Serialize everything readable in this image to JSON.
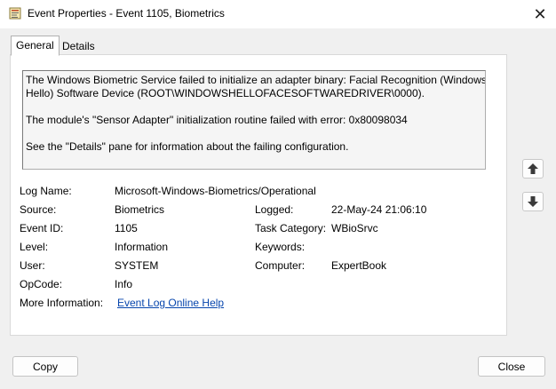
{
  "window": {
    "title": "Event Properties - Event 1105, Biometrics",
    "icon": "event-viewer-icon",
    "close_glyph": "✕"
  },
  "tabs": [
    {
      "label": "General",
      "active": true
    },
    {
      "label": "Details",
      "active": false
    }
  ],
  "description": {
    "line1": "The Windows Biometric Service failed to initialize an adapter binary: Facial Recognition (Windows",
    "line2": "Hello) Software Device (ROOT\\WINDOWSHELLOFACESOFTWAREDRIVER\\0000).",
    "line3": "The module's \"Sensor Adapter\" initialization routine failed with error: 0x80098034",
    "line4": "See the \"Details\" pane for information about the failing configuration."
  },
  "fields": {
    "log_name": {
      "label": "Log Name:",
      "value": "Microsoft-Windows-Biometrics/Operational"
    },
    "source": {
      "label": "Source:",
      "value": "Biometrics"
    },
    "logged": {
      "label": "Logged:",
      "value": "22-May-24 21:06:10"
    },
    "event_id": {
      "label": "Event ID:",
      "value": "1105"
    },
    "task_category": {
      "label": "Task Category:",
      "value": "WBioSrvc"
    },
    "level": {
      "label": "Level:",
      "value": "Information"
    },
    "keywords": {
      "label": "Keywords:",
      "value": ""
    },
    "user": {
      "label": "User:",
      "value": "SYSTEM"
    },
    "computer": {
      "label": "Computer:",
      "value": "ExpertBook"
    },
    "opcode": {
      "label": "OpCode:",
      "value": "Info"
    },
    "more_info": {
      "label": "More Information:",
      "link": "Event Log Online Help"
    }
  },
  "buttons": {
    "copy": "Copy",
    "close": "Close"
  },
  "icons": {
    "up": "arrow-up-icon",
    "down": "arrow-down-icon"
  }
}
